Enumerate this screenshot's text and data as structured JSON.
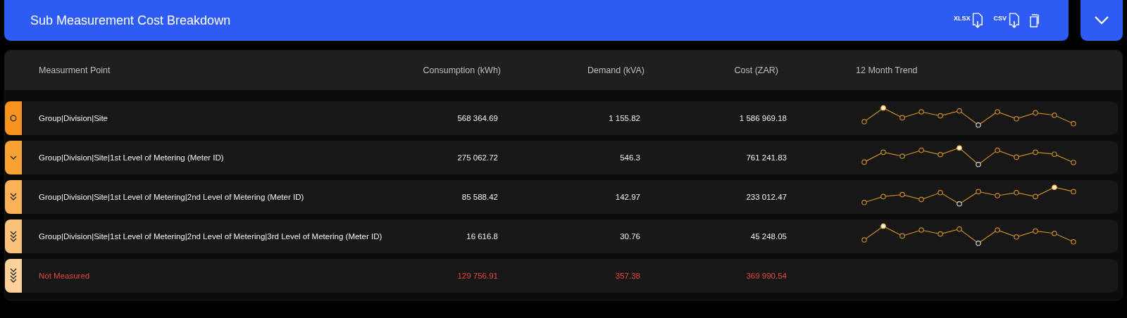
{
  "header": {
    "title": "Sub Measurement Cost Breakdown",
    "exports": [
      {
        "label": "XLSX"
      },
      {
        "label": "CSV"
      }
    ],
    "expanded": true
  },
  "table": {
    "columns": [
      "Measurment Point",
      "Consumption (kWh)",
      "Demand (kVA)",
      "Cost (ZAR)",
      "12 Month Trend"
    ],
    "rows": [
      {
        "kind": "circle",
        "color": "#f7931e",
        "unmeasured": false,
        "point": "Group|Division|Site",
        "consumption": "568 364.69",
        "demand": "1 155.82",
        "cost": "1 586 969.18"
      },
      {
        "kind": "single",
        "color": "#f9a133",
        "unmeasured": false,
        "point": "Group|Division|Site|1st Level of Metering (Meter ID)",
        "consumption": "275 062.72",
        "demand": "546.3",
        "cost": "761 241.83"
      },
      {
        "kind": "double",
        "color": "#fbb258",
        "unmeasured": false,
        "point": "Group|Division|Site|1st Level of Metering|2nd Level of Metering (Meter ID)",
        "consumption": "85 588.42",
        "demand": "142.97",
        "cost": "233 012.47"
      },
      {
        "kind": "triple",
        "color": "#fcc27a",
        "unmeasured": false,
        "point": "Group|Division|Site|1st Level of Metering|2nd Level of Metering|3rd Level of Metering (Meter ID)",
        "consumption": "16 616.8",
        "demand": "30.76",
        "cost": "45 248.05"
      },
      {
        "kind": "quadruple",
        "color": "#fdd29a",
        "unmeasured": true,
        "point": "Not Measured",
        "consumption": "129 756.91",
        "demand": "357.38",
        "cost": "369 990.54"
      }
    ]
  }
}
